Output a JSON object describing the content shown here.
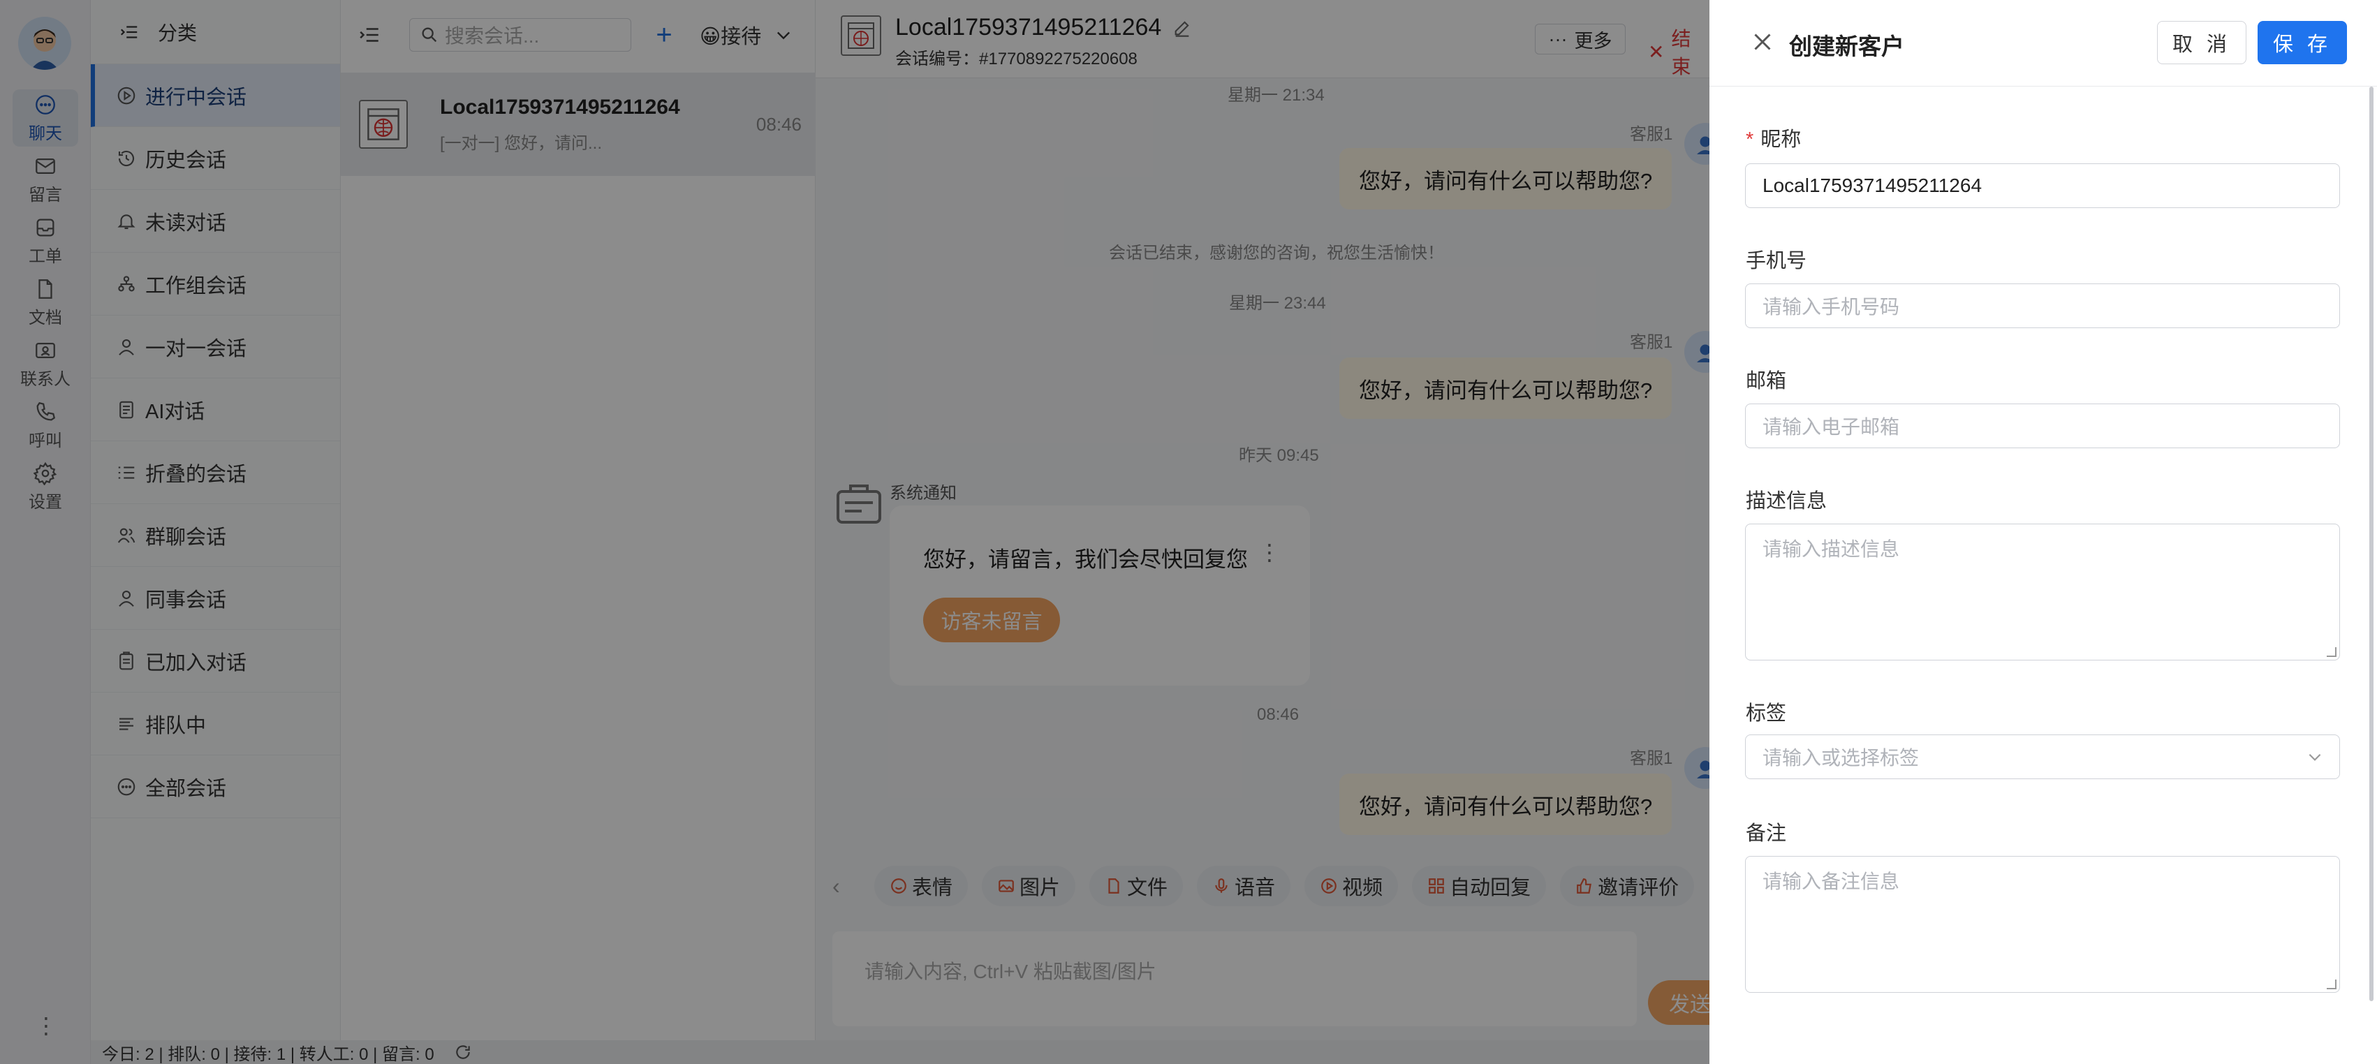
{
  "rail": {
    "items": [
      {
        "label": "聊天",
        "icon": "chat-icon"
      },
      {
        "label": "留言",
        "icon": "mail-icon"
      },
      {
        "label": "工单",
        "icon": "inbox-icon"
      },
      {
        "label": "文档",
        "icon": "document-icon"
      },
      {
        "label": "联系人",
        "icon": "contact-card-icon"
      },
      {
        "label": "呼叫",
        "icon": "phone-icon"
      },
      {
        "label": "设置",
        "icon": "gear-icon"
      }
    ],
    "more": "⋮"
  },
  "categories": {
    "title": "分类",
    "items": [
      {
        "label": "进行中会话",
        "icon": "play-circle-icon"
      },
      {
        "label": "历史会话",
        "icon": "history-icon"
      },
      {
        "label": "未读对话",
        "icon": "bell-icon"
      },
      {
        "label": "工作组会话",
        "icon": "group-tree-icon"
      },
      {
        "label": "一对一会话",
        "icon": "user-icon"
      },
      {
        "label": "AI对话",
        "icon": "robot-doc-icon"
      },
      {
        "label": "折叠的会话",
        "icon": "collapse-list-icon"
      },
      {
        "label": "群聊会话",
        "icon": "group-users-icon"
      },
      {
        "label": "同事会话",
        "icon": "user-icon"
      },
      {
        "label": "已加入对话",
        "icon": "clipboard-icon"
      },
      {
        "label": "排队中",
        "icon": "queue-list-icon"
      },
      {
        "label": "全部会话",
        "icon": "chat-dots-icon"
      }
    ]
  },
  "conversation_list": {
    "search_placeholder": "搜索会话...",
    "reception": "😀接待",
    "items": [
      {
        "name": "Local1759371495211264",
        "preview": "[一对一] 您好，请问...",
        "time": "08:46"
      }
    ]
  },
  "chat": {
    "title": "Local1759371495211264",
    "subtitle": "会话编号：#1770892275220608",
    "more_label": "更多",
    "end_label": "结束",
    "messages": {
      "stamp1": "星期一 21:34",
      "agent": "客服1",
      "reply": "您好，请问有什么可以帮助您?",
      "ended": "会话已结束，感谢您的咨询，祝您生活愉快！",
      "stamp2": "星期一 23:44",
      "stamp3": "昨天 09:45",
      "sys_label": "系统通知",
      "sys_text": "您好，请留言，我们会尽快回复您",
      "sys_button": "访客未留言",
      "stamp4": "08:46"
    },
    "toolbar": [
      "表情",
      "图片",
      "文件",
      "语音",
      "视频",
      "自动回复",
      "邀请评价"
    ],
    "input_placeholder": "请输入内容, Ctrl+V 粘贴截图/图片",
    "send_label": "发送"
  },
  "statusbar": {
    "text": "今日: 2 | 排队: 0 | 接待: 1 | 转人工: 0 | 留言: 0"
  },
  "drawer": {
    "title": "创建新客户",
    "cancel": "取 消",
    "save": "保 存",
    "fields": {
      "nickname_label": "昵称",
      "nickname_value": "Local1759371495211264",
      "phone_label": "手机号",
      "phone_placeholder": "请输入手机号码",
      "email_label": "邮箱",
      "email_placeholder": "请输入电子邮箱",
      "desc_label": "描述信息",
      "desc_placeholder": "请输入描述信息",
      "tags_label": "标签",
      "tags_placeholder": "请输入或选择标签",
      "note_label": "备注",
      "note_placeholder": "请输入备注信息"
    }
  },
  "colors": {
    "primary": "#1f74ee",
    "danger": "#e03a3a",
    "bubble": "#fff7e6",
    "overlay": "rgba(0,0,0,0.45)"
  }
}
